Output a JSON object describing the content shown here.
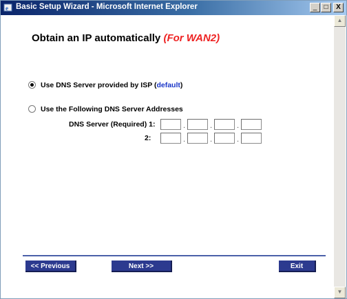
{
  "window": {
    "title": "Basic Setup Wizard - Microsoft Internet Explorer",
    "minimize": "_",
    "maximize": "□",
    "close": "X"
  },
  "page": {
    "heading_main": "Obtain an IP automatically ",
    "heading_wan": "(For WAN2)"
  },
  "dns": {
    "option_isp_label": "Use DNS Server provided by ISP (",
    "option_isp_default": "default",
    "option_isp_close": ")",
    "option_isp_selected": true,
    "option_manual_label": "Use the Following DNS Server Addresses",
    "option_manual_selected": false,
    "server1_label": "DNS Server (Required) 1:",
    "server2_label": "2:",
    "server1_octets": [
      "",
      "",
      "",
      ""
    ],
    "server2_octets": [
      "",
      "",
      "",
      ""
    ],
    "separator": "."
  },
  "buttons": {
    "previous": "<< Previous",
    "next": "Next >>",
    "exit": "Exit"
  },
  "scrollbar": {
    "up_arrow": "▲",
    "down_arrow": "▼"
  },
  "colors": {
    "accent_red": "#ee2222",
    "link_blue": "#1a36c8",
    "button_navy": "#2c3a8f"
  }
}
